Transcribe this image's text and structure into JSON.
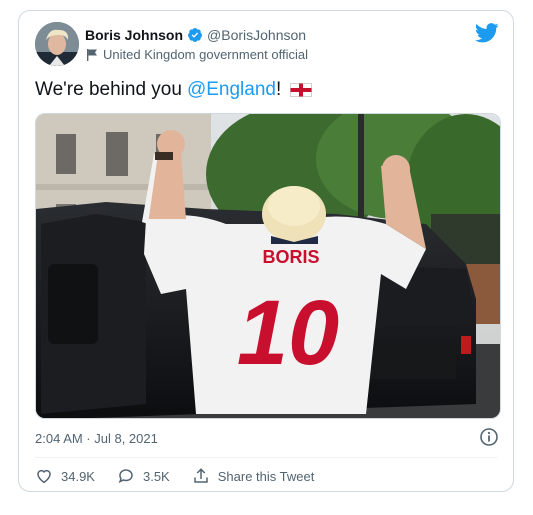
{
  "tweet": {
    "author": {
      "display_name": "Boris Johnson",
      "handle": "@BorisJohnson",
      "label": "United Kingdom government official",
      "verified": true
    },
    "text_prefix": "We're behind you",
    "mention": "@England",
    "text_suffix": "!",
    "timestamp": "2:04 AM · Jul 8, 2021",
    "jersey_name": "BORIS",
    "jersey_number": "10",
    "actions": {
      "likes": "34.9K",
      "replies": "3.5K",
      "share_label": "Share this Tweet"
    }
  },
  "colors": {
    "twitter_blue": "#1d9bf0",
    "secondary_text": "#536471",
    "jersey_red": "#c8102e"
  },
  "icons": [
    "twitter-bird-icon",
    "verified-badge-icon",
    "flag-icon",
    "england-flag-icon",
    "info-icon",
    "heart-icon",
    "reply-icon",
    "share-icon"
  ]
}
